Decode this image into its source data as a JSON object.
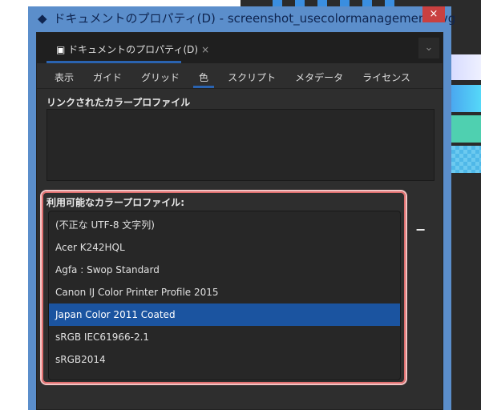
{
  "window": {
    "title": "ドキュメントのプロパティ(D) - screenshot_usecolormanagement.svg",
    "close": "×"
  },
  "dock": {
    "tab_label": "ドキュメントのプロパティ(D)",
    "tab_close": "×",
    "menu": "⌄"
  },
  "tabs": [
    {
      "label": "表示"
    },
    {
      "label": "ガイド"
    },
    {
      "label": "グリッド"
    },
    {
      "label": "色",
      "active": true
    },
    {
      "label": "スクリプト"
    },
    {
      "label": "メタデータ"
    },
    {
      "label": "ライセンス"
    }
  ],
  "linked": {
    "label": "リンクされたカラープロファイル"
  },
  "available": {
    "label": "利用可能なカラープロファイル:",
    "items": [
      "(不正な UTF-8 文字列)",
      "Acer K242HQL",
      "Agfa : Swop Standard",
      "Canon IJ Color Printer Profile 2015",
      "Japan Color 2011 Coated",
      "sRGB IEC61966-2.1",
      "sRGB2014"
    ],
    "selected": "Japan Color 2011 Coated",
    "remove": "−"
  },
  "colors": {
    "accent": "#1b54a0",
    "highlight": "#e07070",
    "titlebar": "#5b8ecb"
  }
}
